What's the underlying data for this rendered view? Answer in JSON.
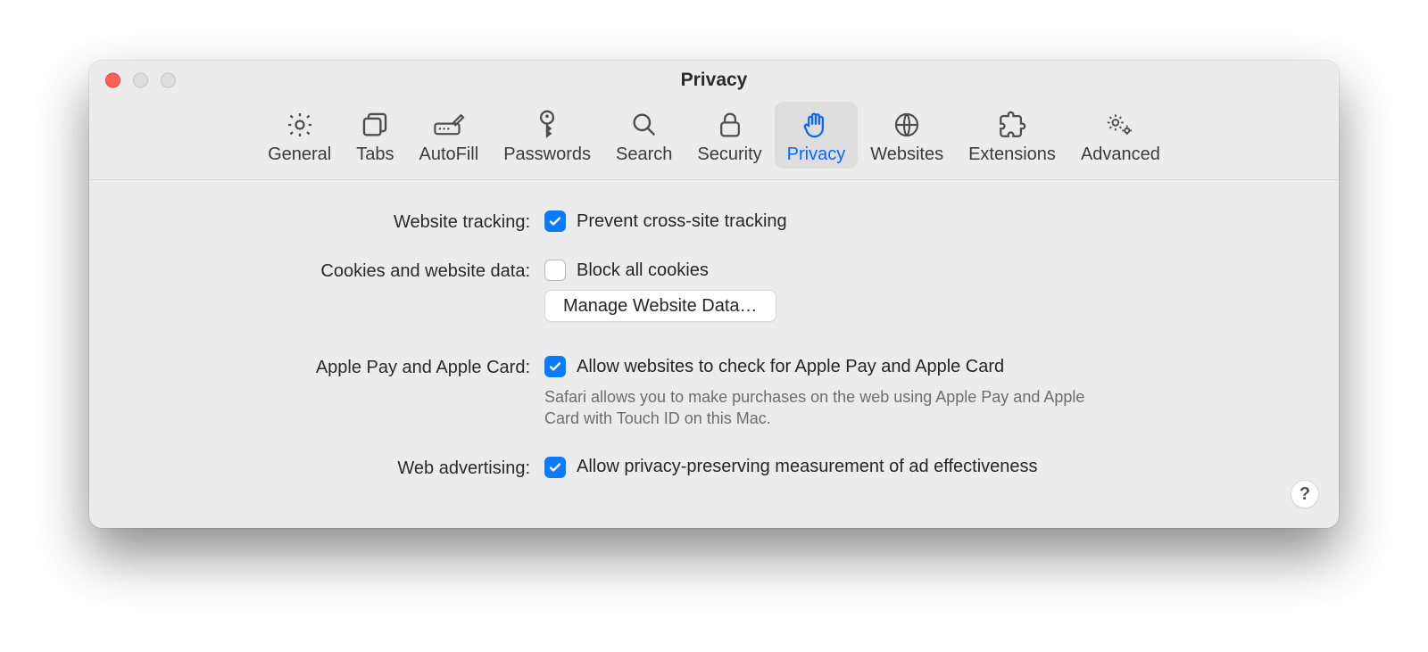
{
  "window": {
    "title": "Privacy"
  },
  "toolbar": {
    "items": [
      {
        "id": "general",
        "label": "General"
      },
      {
        "id": "tabs",
        "label": "Tabs"
      },
      {
        "id": "autofill",
        "label": "AutoFill"
      },
      {
        "id": "passwords",
        "label": "Passwords"
      },
      {
        "id": "search",
        "label": "Search"
      },
      {
        "id": "security",
        "label": "Security"
      },
      {
        "id": "privacy",
        "label": "Privacy"
      },
      {
        "id": "websites",
        "label": "Websites"
      },
      {
        "id": "extensions",
        "label": "Extensions"
      },
      {
        "id": "advanced",
        "label": "Advanced"
      }
    ],
    "active_id": "privacy"
  },
  "sections": {
    "website_tracking": {
      "label": "Website tracking:",
      "checkbox_label": "Prevent cross-site tracking",
      "checked": true
    },
    "cookies": {
      "label": "Cookies and website data:",
      "checkbox_label": "Block all cookies",
      "checked": false,
      "button_label": "Manage Website Data…"
    },
    "apple_pay": {
      "label": "Apple Pay and Apple Card:",
      "checkbox_label": "Allow websites to check for Apple Pay and Apple Card",
      "checked": true,
      "hint": "Safari allows you to make purchases on the web using Apple Pay and Apple Card with Touch ID on this Mac."
    },
    "web_advertising": {
      "label": "Web advertising:",
      "checkbox_label": "Allow privacy-preserving measurement of ad effectiveness",
      "checked": true
    }
  },
  "help_label": "?"
}
